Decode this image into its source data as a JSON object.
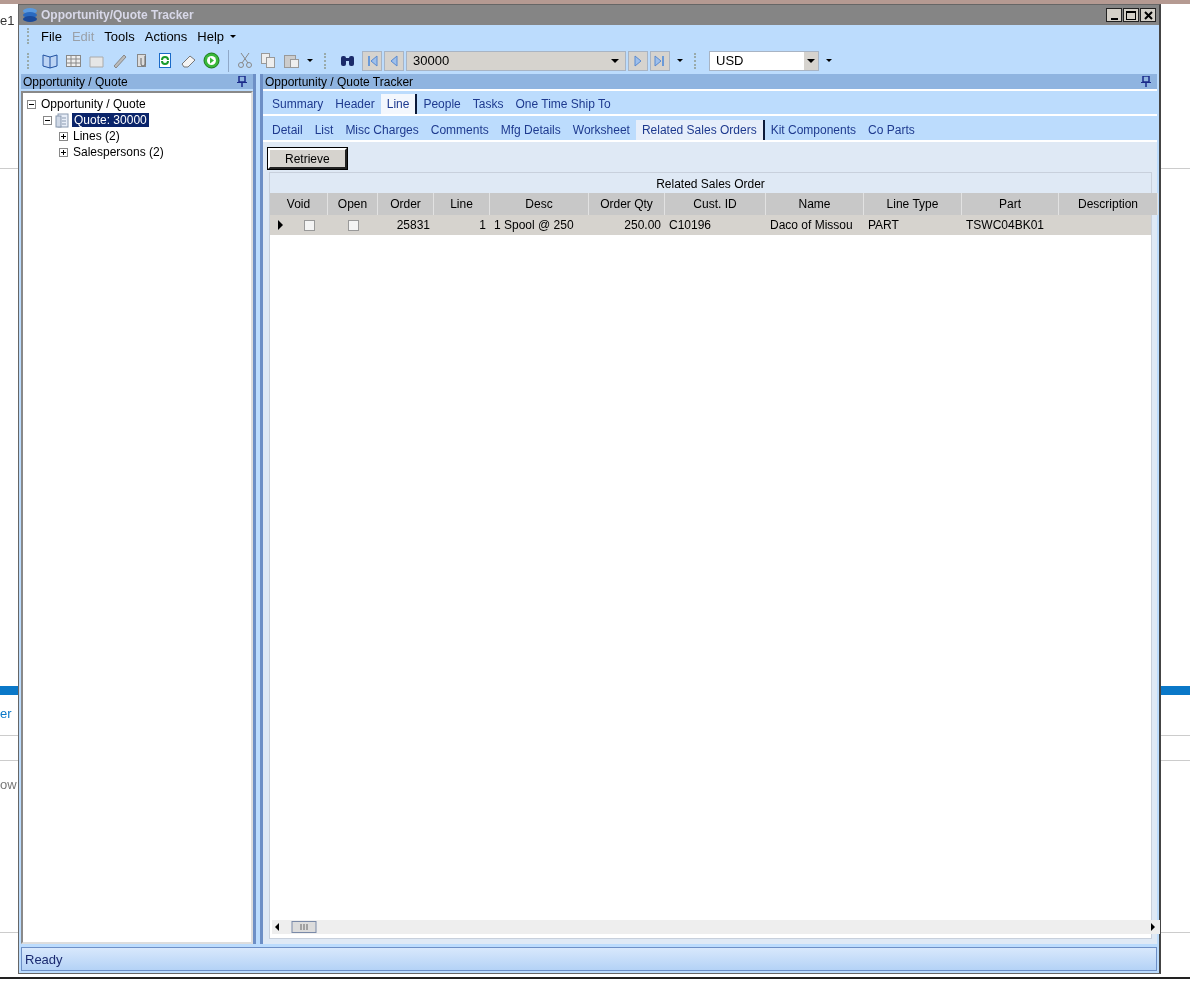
{
  "background_fragments": [
    {
      "text": "e1"
    },
    {
      "text": "er"
    },
    {
      "text": "ow"
    }
  ],
  "window": {
    "title": "Opportunity/Quote Tracker"
  },
  "menu": [
    {
      "label": "File",
      "disabled": false
    },
    {
      "label": "Edit",
      "disabled": true
    },
    {
      "label": "Tools",
      "disabled": false
    },
    {
      "label": "Actions",
      "disabled": false
    },
    {
      "label": "Help",
      "disabled": false
    }
  ],
  "toolbar": {
    "quote_number": "30000",
    "currency": "USD"
  },
  "left_panel": {
    "title": "Opportunity / Quote",
    "tree": [
      {
        "label": "Opportunity / Quote",
        "expanded": true,
        "selected": false,
        "children": [
          {
            "label": "Quote: 30000",
            "expanded": true,
            "selected": true,
            "children": [
              {
                "label": "Lines (2)",
                "expanded": false,
                "selected": false
              },
              {
                "label": "Salespersons (2)",
                "expanded": false,
                "selected": false
              }
            ]
          }
        ]
      }
    ]
  },
  "right_panel": {
    "title": "Opportunity / Quote Tracker",
    "tabs": [
      {
        "label": "Summary",
        "selected": false
      },
      {
        "label": "Header",
        "selected": false
      },
      {
        "label": "Line",
        "selected": true
      },
      {
        "label": "People",
        "selected": false
      },
      {
        "label": "Tasks",
        "selected": false
      },
      {
        "label": "One Time Ship To",
        "selected": false
      }
    ],
    "subtabs": [
      {
        "label": "Detail",
        "selected": false
      },
      {
        "label": "List",
        "selected": false
      },
      {
        "label": "Misc Charges",
        "selected": false
      },
      {
        "label": "Comments",
        "selected": false
      },
      {
        "label": "Mfg Details",
        "selected": false
      },
      {
        "label": "Worksheet",
        "selected": false
      },
      {
        "label": "Related Sales Orders",
        "selected": true
      },
      {
        "label": "Kit Components",
        "selected": false
      },
      {
        "label": "Co Parts",
        "selected": false
      }
    ],
    "retrieve_button": "Retrieve",
    "grid": {
      "title": "Related Sales Order",
      "columns": [
        "Void",
        "Open",
        "Order",
        "Line",
        "Desc",
        "Order Qty",
        "Cust. ID",
        "Name",
        "Line Type",
        "Part",
        "Description"
      ],
      "rows": [
        {
          "current": true,
          "void": false,
          "open": false,
          "cells": [
            "",
            "",
            "25831",
            "1",
            "1  Spool @ 250",
            "250.00",
            "C10196",
            "Daco of Missou",
            "PART",
            "TSWC04BK01"
          ]
        }
      ]
    }
  },
  "status_bar": "Ready"
}
